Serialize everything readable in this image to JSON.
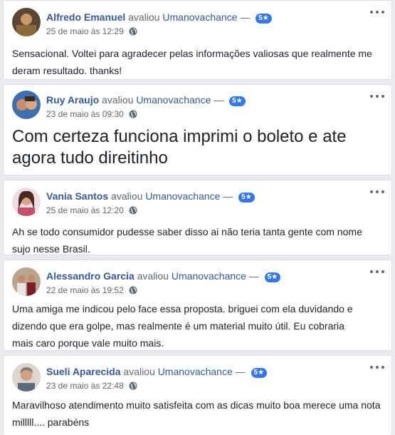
{
  "reviews": [
    {
      "name": "Alfredo Emanuel",
      "verb": "avaliou",
      "page": "Umanovachance",
      "dash": "—",
      "rating": "5★",
      "date": "25 de maio às 12:29",
      "text": "Sensacional. Voltei para agradecer pelas informações valiosas que realmente me deram resultado. thanks!"
    },
    {
      "name": "Ruy Araujo",
      "verb": "avaliou",
      "page": "Umanovachance",
      "dash": "—",
      "rating": "5★",
      "date": "23 de maio às 09:30",
      "text": "Com certeza funciona imprimi o boleto e ate agora tudo direitinho"
    },
    {
      "name": "Vania Santos",
      "verb": "avaliou",
      "page": "Umanovachance",
      "dash": "—",
      "rating": "5★",
      "date": "25 de maio às 12:20",
      "text": "Ah se todo consumidor pudesse saber disso ai não teria tanta gente com nome sujo nesse Brasil."
    },
    {
      "name": "Alessandro Garcia",
      "verb": "avaliou",
      "page": "Umanovachance",
      "dash": "—",
      "rating": "5★",
      "date": "22 de maio às 19:52",
      "text": "Uma amiga me indicou pelo face essa proposta. briguei com ela duvidando e dizendo que era golpe, mas realmente é um material muito útil. Eu cobraria mais caro porque vale muito mais."
    },
    {
      "name": "Sueli Aparecida",
      "verb": "avaliou",
      "page": "Umanovachance",
      "dash": "—",
      "rating": "5★",
      "date": "23 de maio às 22:48",
      "text": "Maravilhoso atendimento muito satisfeita com as dicas muito boa merece uma nota milllll.... parabéns"
    }
  ],
  "colors": {
    "name_link": "#365899",
    "badge": "#3578e5",
    "meta": "#616770",
    "background": "#e9ebee"
  },
  "icons": {
    "privacy": "globe-icon",
    "options": "more-options-icon"
  }
}
